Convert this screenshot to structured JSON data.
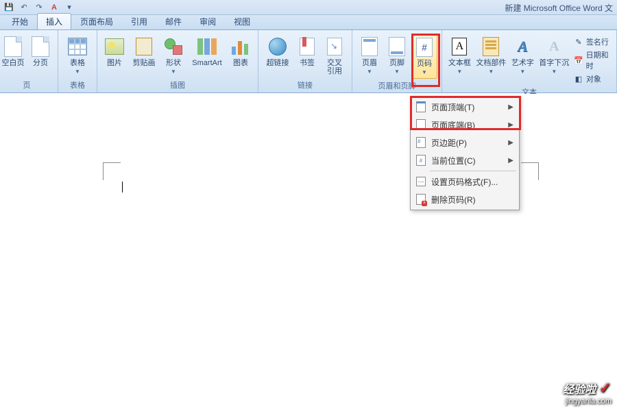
{
  "window": {
    "title": "新建 Microsoft Office Word 文"
  },
  "tabs": {
    "home": "开始",
    "insert": "插入",
    "layout": "页面布局",
    "refs": "引用",
    "mail": "邮件",
    "review": "审阅",
    "view": "视图"
  },
  "groups": {
    "pages": {
      "label": "页",
      "cover": "空白页",
      "break": "分页"
    },
    "tables": {
      "label": "表格",
      "table": "表格"
    },
    "illus": {
      "label": "插图",
      "picture": "图片",
      "clipart": "剪贴画",
      "shapes": "形状",
      "smartart": "SmartArt",
      "chart": "图表"
    },
    "links": {
      "label": "链接",
      "hyperlink": "超链接",
      "bookmark": "书签",
      "crossref": "交叉\n引用"
    },
    "hf": {
      "label": "页眉和页脚",
      "header": "页眉",
      "footer": "页脚",
      "pagenum": "页码"
    },
    "text": {
      "label": "文本",
      "textbox": "文本框",
      "parts": "文档部件",
      "wordart": "艺术字",
      "dropcap": "首字下沉",
      "sig": "签名行",
      "date": "日期和时",
      "obj": "对象"
    }
  },
  "pagenum_icon_char": "#",
  "textbox_icon_char": "A",
  "wordart_icon_char": "A",
  "dropcap_icon_char": "A",
  "dropdown": {
    "top": "页面顶端(T)",
    "bottom": "页面底端(B)",
    "margins": "页边距(P)",
    "current": "当前位置(C)",
    "format": "设置页码格式(F)...",
    "remove": "删除页码(R)"
  },
  "watermark": {
    "brand": "经验啦",
    "url": "jingyanla.com"
  }
}
